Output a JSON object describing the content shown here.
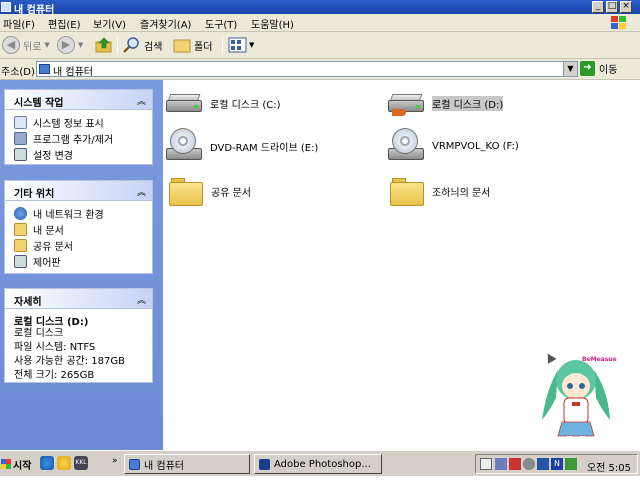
{
  "window": {
    "title": "내 컴퓨터",
    "controls": [
      "_",
      "□",
      "×"
    ]
  },
  "menu": {
    "items": [
      "파일(F)",
      "편집(E)",
      "보기(V)",
      "즐겨찾기(A)",
      "도구(T)",
      "도움말(H)"
    ]
  },
  "toolbar": {
    "back_label": "뒤로",
    "search_label": "검색",
    "folders_label": "폴더"
  },
  "address": {
    "label": "주소(D)",
    "value": "내 컴퓨터",
    "go_label": "이동"
  },
  "panels": {
    "system_tasks": {
      "title": "시스템 작업",
      "items": [
        "시스템 정보 표시",
        "프로그램 추가/제거",
        "설정 변경"
      ]
    },
    "other_places": {
      "title": "기타 위치",
      "items": [
        "내 네트워크 환경",
        "내 문서",
        "공유 문서",
        "제어판"
      ]
    },
    "details": {
      "title": "자세히",
      "name": "로컬 디스크 (D:)",
      "type": "로컬 디스크",
      "filesystem": "파일 시스템: NTFS",
      "free": "사용 가능한 공간: 187GB",
      "total": "전체 크기: 265GB"
    }
  },
  "items": {
    "drive_c": "로컬 디스크 (C:)",
    "drive_d": "로컬 디스크 (D:)",
    "drive_e": "DVD-RAM 드라이브 (E:)",
    "drive_f": "VRMPVOL_KO (F:)",
    "shared_docs": "공유 문서",
    "user_docs": "조하늬의 문서"
  },
  "mascot_label": "BeMeasue",
  "taskbar": {
    "start_label": "시작",
    "tasks": [
      "내 컴퓨터",
      "Adobe Photoshop..."
    ],
    "clock": "오전 5:05"
  },
  "colors": {
    "title_blue": "#1a45a8",
    "panel_blue": "#6c8bd4",
    "folder_yellow": "#e8c34a"
  }
}
